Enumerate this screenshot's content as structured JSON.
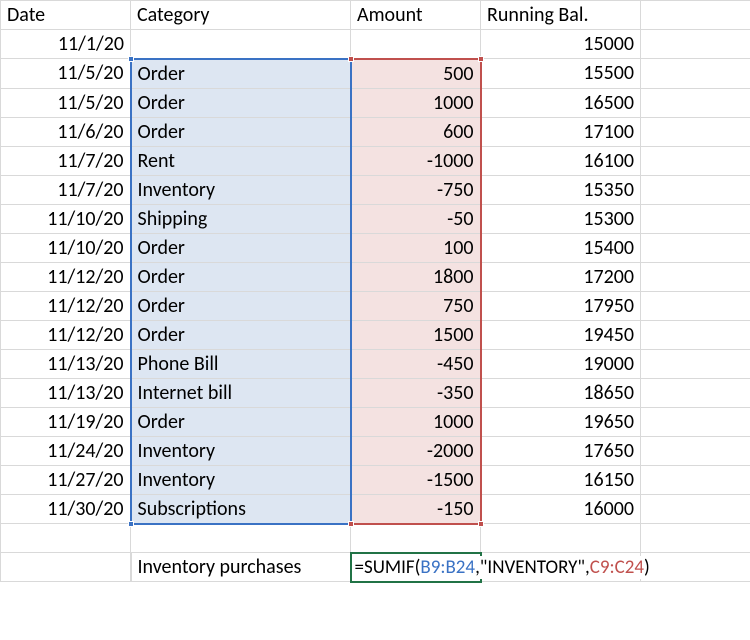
{
  "headers": {
    "date": "Date",
    "category": "Category",
    "amount": "Amount",
    "balance": "Running Bal."
  },
  "rows": [
    {
      "date": "11/1/20",
      "category": "",
      "amount": "",
      "balance": "15000"
    },
    {
      "date": "11/5/20",
      "category": "Order",
      "amount": "500",
      "balance": "15500"
    },
    {
      "date": "11/5/20",
      "category": "Order",
      "amount": "1000",
      "balance": "16500"
    },
    {
      "date": "11/6/20",
      "category": "Order",
      "amount": "600",
      "balance": "17100"
    },
    {
      "date": "11/7/20",
      "category": "Rent",
      "amount": "-1000",
      "balance": "16100"
    },
    {
      "date": "11/7/20",
      "category": "Inventory",
      "amount": "-750",
      "balance": "15350"
    },
    {
      "date": "11/10/20",
      "category": "Shipping",
      "amount": "-50",
      "balance": "15300"
    },
    {
      "date": "11/10/20",
      "category": "Order",
      "amount": "100",
      "balance": "15400"
    },
    {
      "date": "11/12/20",
      "category": "Order",
      "amount": "1800",
      "balance": "17200"
    },
    {
      "date": "11/12/20",
      "category": "Order",
      "amount": "750",
      "balance": "17950"
    },
    {
      "date": "11/12/20",
      "category": "Order",
      "amount": "1500",
      "balance": "19450"
    },
    {
      "date": "11/13/20",
      "category": "Phone Bill",
      "amount": "-450",
      "balance": "19000"
    },
    {
      "date": "11/13/20",
      "category": "Internet bill",
      "amount": "-350",
      "balance": "18650"
    },
    {
      "date": "11/19/20",
      "category": "Order",
      "amount": "1000",
      "balance": "19650"
    },
    {
      "date": "11/24/20",
      "category": "Inventory",
      "amount": "-2000",
      "balance": "17650"
    },
    {
      "date": "11/27/20",
      "category": "Inventory",
      "amount": "-1500",
      "balance": "16150"
    },
    {
      "date": "11/30/20",
      "category": "Subscriptions",
      "amount": "-150",
      "balance": "16000"
    }
  ],
  "summary": {
    "label": "Inventory purchases",
    "formula": {
      "prefix": "=SUMIF(",
      "range1": "B9:B24",
      "sep1": ",",
      "criteria": "\"INVENTORY\"",
      "sep2": ",",
      "range2": "C9:C24",
      "suffix": ")"
    }
  }
}
